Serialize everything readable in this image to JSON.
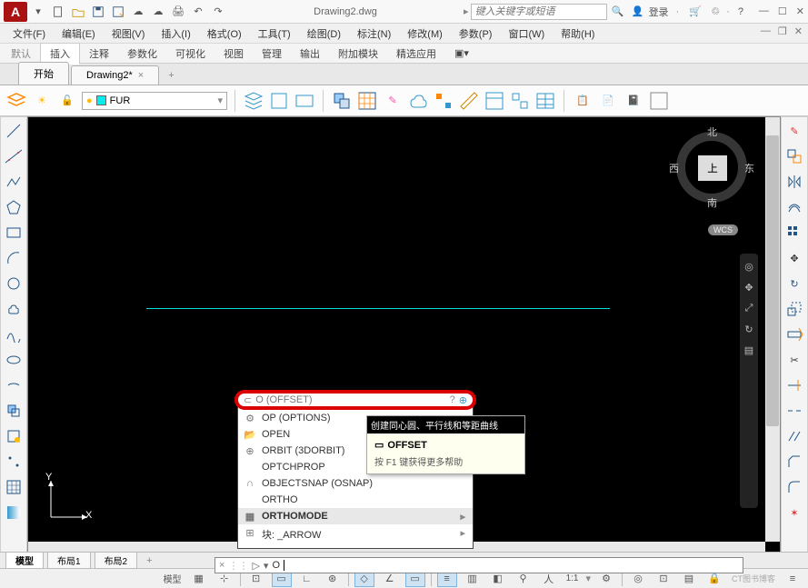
{
  "app_icon_letter": "A",
  "title": "Drawing2.dwg",
  "search_placeholder": "键入关键字或短语",
  "login_label": "登录",
  "menubar": [
    "文件(F)",
    "编辑(E)",
    "视图(V)",
    "插入(I)",
    "格式(O)",
    "工具(T)",
    "绘图(D)",
    "标注(N)",
    "修改(M)",
    "参数(P)",
    "窗口(W)",
    "帮助(H)"
  ],
  "ribbon_tabs": {
    "first": "默认",
    "items": [
      "插入",
      "注释",
      "参数化",
      "可视化",
      "视图",
      "管理",
      "输出",
      "附加模块",
      "精选应用"
    ],
    "active": 0
  },
  "file_tabs": {
    "items": [
      {
        "label": "开始",
        "closable": false
      },
      {
        "label": "Drawing2*",
        "closable": true
      }
    ],
    "add": "+"
  },
  "layer_combo": {
    "name": "FUR"
  },
  "viewcube": {
    "top": "上",
    "n": "北",
    "s": "南",
    "e": "东",
    "w": "西",
    "wcs": "WCS"
  },
  "ucs": {
    "x": "X",
    "y": "Y"
  },
  "cmd_popup": {
    "input": "O (OFFSET)",
    "items": [
      {
        "icon": "⚙",
        "label": "OP (OPTIONS)"
      },
      {
        "icon": "📂",
        "label": "OPEN"
      },
      {
        "icon": "⊕",
        "label": "ORBIT (3DORBIT)"
      },
      {
        "icon": "",
        "label": "OPTCHPROP"
      },
      {
        "icon": "∩",
        "label": "OBJECTSNAP (OSNAP)"
      },
      {
        "icon": "",
        "label": "ORTHO"
      },
      {
        "icon": "▦",
        "label": "ORTHOMODE",
        "hl": true,
        "arrow": true
      },
      {
        "icon": "⊞",
        "label": "块: _ARROW",
        "arrow": true
      }
    ]
  },
  "tooltip": {
    "line1": "创建同心圆、平行线和等距曲线",
    "title_icon": "▭",
    "title": "OFFSET",
    "line3": "按 F1 键获得更多帮助"
  },
  "cmdline": {
    "close": "×",
    "prompt_icon": "▷",
    "text": "O"
  },
  "layout_tabs": {
    "items": [
      "模型",
      "布局1",
      "布局2"
    ],
    "active": 0,
    "add": "+"
  },
  "status": {
    "left_label": "模型",
    "scale": "1:1",
    "watermark": "CT图书博客"
  }
}
